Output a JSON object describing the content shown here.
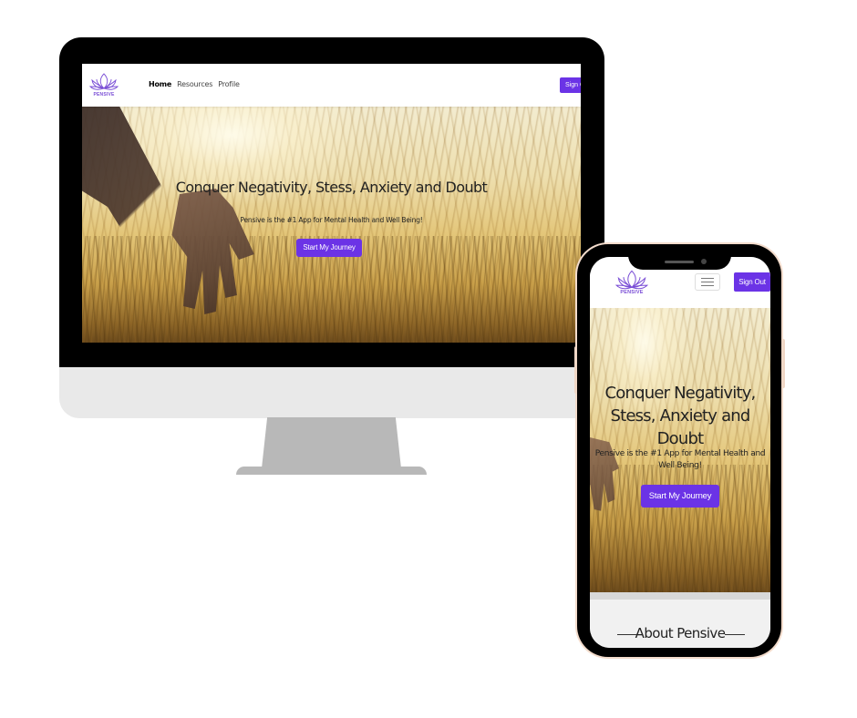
{
  "desktop": {
    "nav": {
      "logo_icon": "lotus-logo-icon",
      "logo_text": "PENSIVE",
      "links": [
        {
          "label": "Home",
          "active": true
        },
        {
          "label": "Resources",
          "active": false
        },
        {
          "label": "Profile",
          "active": false
        }
      ],
      "sign_out_label": "Sign Out"
    },
    "hero": {
      "title": "Conquer Negativity, Stess, Anxiety and Doubt",
      "subtitle": "Pensive is the #1 App for Mental Health and Well Being!",
      "cta_label": "Start My Journey"
    }
  },
  "mobile": {
    "nav": {
      "logo_icon": "lotus-logo-icon",
      "logo_text": "PENSIVE",
      "menu_icon": "hamburger-menu-icon",
      "sign_out_label": "Sign Out"
    },
    "hero": {
      "title": "Conquer Negativity, Stess, Anxiety and Doubt",
      "subtitle": "Pensive is the #1 App for Mental Health and Well Being!",
      "cta_label": "Start My Journey"
    },
    "about": {
      "heading": "About Pensive"
    }
  },
  "colors": {
    "accent": "#6b33e6",
    "logo": "#7b4fd6"
  }
}
